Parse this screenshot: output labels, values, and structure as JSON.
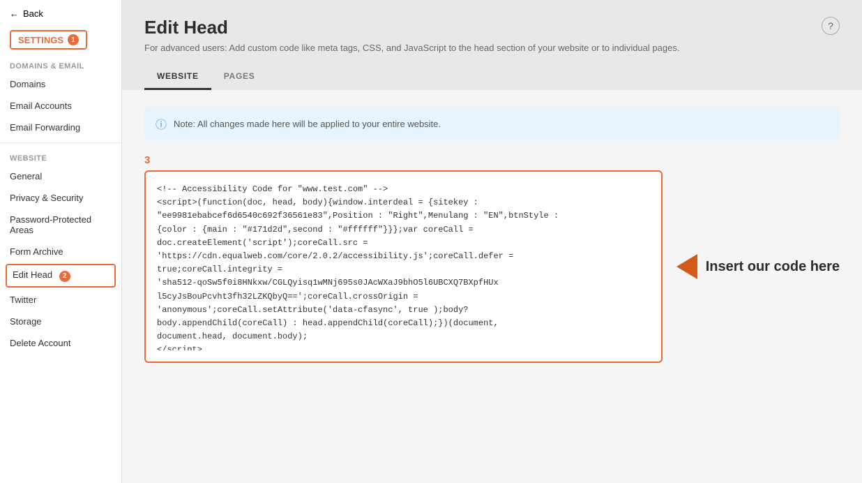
{
  "sidebar": {
    "back_label": "Back",
    "settings_label": "SETTINGS",
    "settings_badge": "1",
    "sections": [
      {
        "label": "DOMAINS & EMAIL",
        "items": [
          {
            "id": "domains",
            "label": "Domains",
            "active": false
          },
          {
            "id": "email-accounts",
            "label": "Email Accounts",
            "active": false
          },
          {
            "id": "email-forwarding",
            "label": "Email Forwarding",
            "active": false
          }
        ]
      },
      {
        "label": "WEBSITE",
        "items": [
          {
            "id": "general",
            "label": "General",
            "active": false
          },
          {
            "id": "privacy-security",
            "label": "Privacy & Security",
            "active": false
          },
          {
            "id": "password-protected-areas",
            "label": "Password-Protected Areas",
            "active": false
          },
          {
            "id": "form-archive",
            "label": "Form Archive",
            "active": false
          },
          {
            "id": "edit-head",
            "label": "Edit Head",
            "active": true
          },
          {
            "id": "twitter",
            "label": "Twitter",
            "active": false
          },
          {
            "id": "storage",
            "label": "Storage",
            "active": false
          },
          {
            "id": "delete-account",
            "label": "Delete Account",
            "active": false
          }
        ]
      }
    ]
  },
  "page": {
    "title": "Edit Head",
    "subtitle": "For advanced users: Add custom code like meta tags, CSS, and JavaScript to the head section of your website or to individual pages.",
    "help_label": "?"
  },
  "tabs": [
    {
      "id": "website",
      "label": "WEBSITE",
      "active": true
    },
    {
      "id": "pages",
      "label": "PAGES",
      "active": false
    }
  ],
  "info_banner": {
    "text": "Note: All changes made here will be applied to your entire website."
  },
  "step_number": "3",
  "badge_number_2": "2",
  "code_content": "<!-- Accessibility Code for \"www.test.com\" -->\n<script>(function(doc, head, body){window.interdeal = {sitekey :\n\"ee9981ebabcef6d6540c692f36561e83\",Position : \"Right\",Menulang : \"EN\",btnStyle :\n{color : {main : \"#171d2d\",second : \"#ffffff\"}}};var coreCall =\ndoc.createElement('script');coreCall.src =\n'https://cdn.equalweb.com/core/2.0.2/accessibility.js';coreCall.defer =\ntrue;coreCall.integrity =\n'sha512-qoSw5f0i8HNkxw/CGLQyisq1wMNj695s0JAcWXaJ9bhO5l6UBCXQ7BXpfHUx\nl5cyJsBouPcvht3fh32LZKQbyQ==';coreCall.crossOrigin =\n'anonymous';coreCall.setAttribute('data-cfasync', true );body?\nbody.appendChild(coreCall) : head.appendChild(coreCall);})(document,\ndocument.head, document.body);\n</script>",
  "annotation": {
    "arrow_label": "Insert our code here"
  }
}
